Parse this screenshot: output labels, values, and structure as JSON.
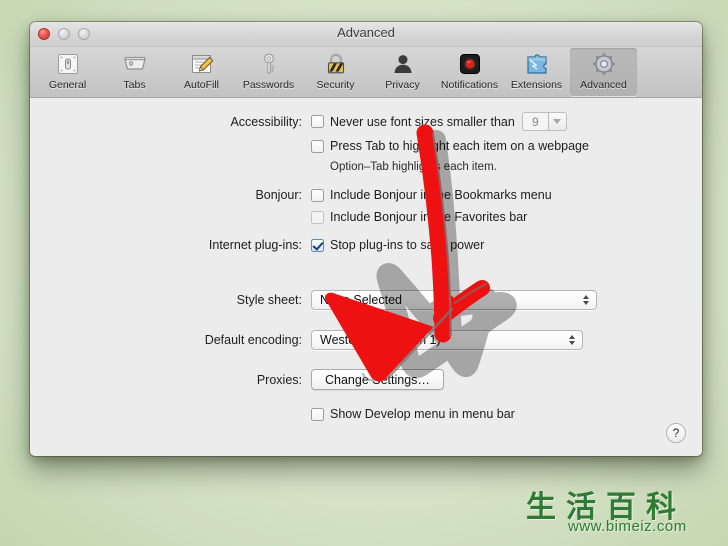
{
  "window": {
    "title": "Advanced",
    "traffic_lights": [
      "close",
      "minimize",
      "zoom"
    ]
  },
  "toolbar": {
    "items": [
      {
        "label": "General",
        "icon": "general-icon",
        "selected": false
      },
      {
        "label": "Tabs",
        "icon": "tabs-icon",
        "selected": false
      },
      {
        "label": "AutoFill",
        "icon": "autofill-icon",
        "selected": false
      },
      {
        "label": "Passwords",
        "icon": "passwords-key-icon",
        "selected": false
      },
      {
        "label": "Security",
        "icon": "security-lock-icon",
        "selected": false
      },
      {
        "label": "Privacy",
        "icon": "privacy-person-icon",
        "selected": false
      },
      {
        "label": "Notifications",
        "icon": "notifications-icon",
        "selected": false
      },
      {
        "label": "Extensions",
        "icon": "extensions-puzzle-icon",
        "selected": false
      },
      {
        "label": "Advanced",
        "icon": "advanced-gear-icon",
        "selected": true
      }
    ]
  },
  "panel": {
    "accessibility": {
      "label": "Accessibility:",
      "never_use_font_sizes": {
        "text": "Never use font sizes smaller than",
        "checked": false
      },
      "font_size_value": "9",
      "press_tab": {
        "text": "Press Tab to highlight each item on a webpage",
        "checked": false
      },
      "hint": "Option–Tab highlights each item."
    },
    "bonjour": {
      "label": "Bonjour:",
      "bookmarks_menu": {
        "text": "Include Bonjour in the Bookmarks menu",
        "checked": false
      },
      "favorites_bar": {
        "text": "Include Bonjour in the Favorites bar",
        "checked": false,
        "disabled": true
      }
    },
    "internet_plugins": {
      "label": "Internet plug-ins:",
      "stop_plugins": {
        "text": "Stop plug-ins to save power",
        "checked": true
      }
    },
    "style_sheet": {
      "label": "Style sheet:",
      "value": "None Selected"
    },
    "default_encoding": {
      "label": "Default encoding:",
      "value": "Western (ISO Latin 1)"
    },
    "proxies": {
      "label": "Proxies:",
      "button_label": "Change Settings…"
    },
    "develop_menu": {
      "text": "Show Develop menu in menu bar",
      "checked": false
    },
    "help_button_label": "?"
  },
  "annotation": {
    "arrow_color": "#ee1111",
    "arrow_outline": "#6e6e6e",
    "points_to": "Change Settings…"
  },
  "watermark": {
    "chinese": "生活百科",
    "url": "www.bimeiz.com",
    "color": "#2f7a34"
  }
}
